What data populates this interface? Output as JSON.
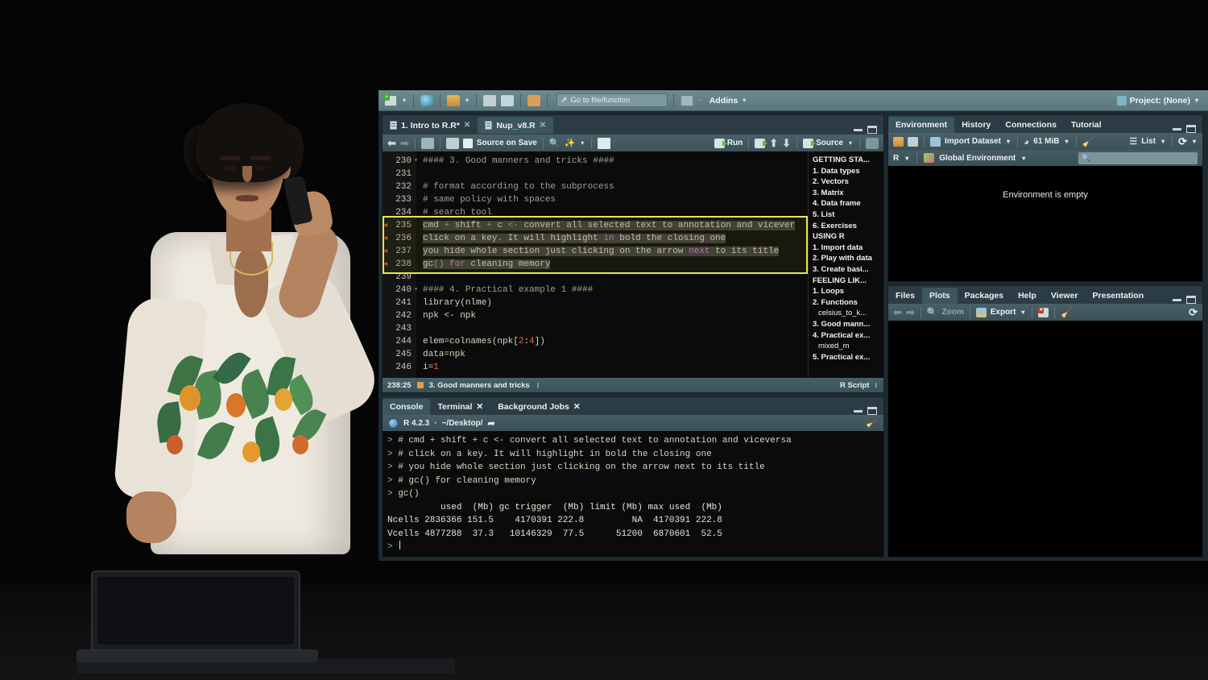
{
  "app": {
    "name": "RStudio"
  },
  "main_toolbar": {
    "icons": [
      "new-file-icon",
      "new-project-icon",
      "open-file-icon",
      "save-icon",
      "save-all-icon",
      "print-icon"
    ],
    "goto": {
      "placeholder": "Go to file/function",
      "icon": "magnifier-arrow-icon"
    },
    "addins_label": "Addins",
    "project_label": "Project: (None)"
  },
  "source_pane": {
    "tabs": [
      {
        "label": "1. Intro to R.R*",
        "active": false,
        "closable": true
      },
      {
        "label": "Nup_v8.R",
        "active": true,
        "closable": true
      }
    ],
    "toolbar": {
      "back_icon": "back-arrow-icon",
      "forward_icon": "forward-arrow-icon",
      "show_doc_outline_icon": "show-in-new-window-icon",
      "save_icon": "save-icon",
      "source_on_save_label": "Source on Save",
      "find_icon": "magnifier-icon",
      "magic_icon": "code-tools-icon",
      "compile_report_icon": "compile-report-icon",
      "run_label": "Run",
      "rerun_icon": "rerun-icon",
      "prev_chunk_icon": "up-arrow-icon",
      "next_chunk_icon": "down-arrow-icon",
      "source_label": "Source",
      "outline_icon": "outline-toggle-icon"
    },
    "code_lines": [
      {
        "num": "230",
        "fold": true,
        "segments": [
          {
            "t": "#### 3. Good manners and tricks ####",
            "c": "kw-com"
          }
        ]
      },
      {
        "num": "231",
        "fold": false,
        "segments": [
          {
            "t": "",
            "c": ""
          }
        ]
      },
      {
        "num": "232",
        "fold": false,
        "segments": [
          {
            "t": "# format according to the subprocess",
            "c": "kw-com"
          }
        ]
      },
      {
        "num": "233",
        "fold": false,
        "segments": [
          {
            "t": "# same policy with spaces",
            "c": "kw-com"
          }
        ]
      },
      {
        "num": "234",
        "fold": false,
        "segments": [
          {
            "t": "# search tool",
            "c": "kw-com"
          }
        ]
      },
      {
        "num": "235",
        "fold": false,
        "breakpoint": true,
        "selected": true,
        "segments": [
          {
            "t": "cmd ",
            "c": "kw-fn"
          },
          {
            "t": "+",
            "c": "kw-op"
          },
          {
            "t": " shift ",
            "c": "kw-fn"
          },
          {
            "t": "+",
            "c": "kw-op"
          },
          {
            "t": " c ",
            "c": "kw-fn"
          },
          {
            "t": "<-",
            "c": "kw-op"
          },
          {
            "t": " convert all selected text to annotation and vicever",
            "c": "kw-fn"
          }
        ]
      },
      {
        "num": "236",
        "fold": false,
        "breakpoint": true,
        "selected": true,
        "segments": [
          {
            "t": "click on a key. It will highlight ",
            "c": "kw-fn"
          },
          {
            "t": "in",
            "c": "kw-pk"
          },
          {
            "t": " bold the closing one",
            "c": "kw-fn"
          }
        ]
      },
      {
        "num": "237",
        "fold": false,
        "breakpoint": true,
        "selected": true,
        "segments": [
          {
            "t": "you hide whole section just clicking on the arrow ",
            "c": "kw-fn"
          },
          {
            "t": "next",
            "c": "kw-pk"
          },
          {
            "t": " to its title",
            "c": "kw-fn"
          }
        ]
      },
      {
        "num": "238",
        "fold": false,
        "breakpoint": true,
        "selected": true,
        "segments": [
          {
            "t": "gc",
            "c": "kw-fn"
          },
          {
            "t": "()",
            "c": "kw-op"
          },
          {
            "t": " for",
            "c": "kw-pk"
          },
          {
            "t": " cleaning memory",
            "c": "kw-fn"
          }
        ]
      },
      {
        "num": "239",
        "fold": false,
        "segments": [
          {
            "t": "",
            "c": ""
          }
        ]
      },
      {
        "num": "240",
        "fold": true,
        "segments": [
          {
            "t": "#### 4. Practical example 1 ####",
            "c": "kw-com"
          }
        ]
      },
      {
        "num": "241",
        "fold": false,
        "segments": [
          {
            "t": "library(nlme)",
            "c": "kw-fn"
          }
        ]
      },
      {
        "num": "242",
        "fold": false,
        "segments": [
          {
            "t": "npk <- npk",
            "c": "kw-fn"
          }
        ]
      },
      {
        "num": "243",
        "fold": false,
        "segments": [
          {
            "t": "",
            "c": ""
          }
        ]
      },
      {
        "num": "244",
        "fold": false,
        "segments": [
          {
            "t": "elem=colnames(npk[",
            "c": "kw-fn"
          },
          {
            "t": "2",
            "c": "kw-num"
          },
          {
            "t": ":",
            "c": "kw-fn"
          },
          {
            "t": "4",
            "c": "kw-num"
          },
          {
            "t": "])",
            "c": "kw-fn"
          }
        ]
      },
      {
        "num": "245",
        "fold": false,
        "segments": [
          {
            "t": "data=npk",
            "c": "kw-fn"
          }
        ]
      },
      {
        "num": "246",
        "fold": false,
        "segments": [
          {
            "t": "i=",
            "c": "kw-fn"
          },
          {
            "t": "1",
            "c": "kw-num"
          }
        ]
      }
    ],
    "outline": [
      {
        "label": "GETTING STA...",
        "sub": false
      },
      {
        "label": "1. Data types",
        "sub": false
      },
      {
        "label": "2. Vectors",
        "sub": false
      },
      {
        "label": "3. Matrix",
        "sub": false
      },
      {
        "label": "4. Data frame",
        "sub": false
      },
      {
        "label": "5. List",
        "sub": false
      },
      {
        "label": "6. Exercises",
        "sub": false
      },
      {
        "label": "USING R",
        "sub": false
      },
      {
        "label": "1. Import data",
        "sub": false
      },
      {
        "label": "2. Play with data",
        "sub": false
      },
      {
        "label": "3. Create basi...",
        "sub": false
      },
      {
        "label": "FEELING LIK...",
        "sub": false
      },
      {
        "label": "1. Loops",
        "sub": false
      },
      {
        "label": "2. Functions",
        "sub": false
      },
      {
        "label": "celsius_to_k...",
        "sub": true
      },
      {
        "label": "3. Good mann...",
        "sub": false
      },
      {
        "label": "4. Practical ex...",
        "sub": false
      },
      {
        "label": "mixed_m",
        "sub": true
      },
      {
        "label": "5. Practical ex...",
        "sub": false
      }
    ],
    "status": {
      "cursor_position": "238:25",
      "section_label": "3. Good manners and tricks",
      "file_type": "R Script"
    }
  },
  "console_pane": {
    "tabs": [
      {
        "label": "Console",
        "active": true,
        "closable": false
      },
      {
        "label": "Terminal",
        "active": false,
        "closable": true
      },
      {
        "label": "Background Jobs",
        "active": false,
        "closable": true
      }
    ],
    "path_row": {
      "version": "R 4.2.3",
      "separator": "·",
      "path": "~/Desktop/",
      "broom_icon": "broom-icon"
    },
    "lines": [
      {
        "prompt": "> ",
        "text": "# cmd + shift + c <- convert all selected text to annotation and viceversa",
        "cls": "cmt"
      },
      {
        "prompt": "> ",
        "text": "# click on a key. It will highlight in bold the closing one",
        "cls": "cmt"
      },
      {
        "prompt": "> ",
        "text": "# you hide whole section just clicking on the arrow next to its title",
        "cls": "cmt"
      },
      {
        "prompt": "> ",
        "text": "# gc() for cleaning memory",
        "cls": "cmt"
      },
      {
        "prompt": "> ",
        "text": "gc()",
        "cls": "cmt"
      },
      {
        "prompt": "",
        "text": "          used  (Mb) gc trigger  (Mb) limit (Mb) max used  (Mb)",
        "cls": ""
      },
      {
        "prompt": "",
        "text": "Ncells 2836366 151.5    4170391 222.8         NA  4170391 222.8",
        "cls": ""
      },
      {
        "prompt": "",
        "text": "Vcells 4877288  37.3   10146329  77.5      51200  6870601  52.5",
        "cls": ""
      }
    ],
    "final_prompt": "> "
  },
  "env_pane": {
    "tabs": [
      {
        "label": "Environment",
        "active": true
      },
      {
        "label": "History",
        "active": false
      },
      {
        "label": "Connections",
        "active": false
      },
      {
        "label": "Tutorial",
        "active": false
      }
    ],
    "toolbar": {
      "load_icon": "open-folder-icon",
      "save_icon": "save-icon",
      "import_label": "Import Dataset",
      "memory_label": "61 MiB",
      "memory_icon": "memory-gauge-icon",
      "clear_icon": "broom-icon",
      "view_label": "List",
      "view_icon": "list-icon",
      "refresh_icon": "refresh-icon"
    },
    "scope_row": {
      "language": "R",
      "environment_label": "Global Environment",
      "env_icon": "globe-cube-icon",
      "search_placeholder": "",
      "search_icon": "search-icon"
    },
    "empty_message": "Environment is empty"
  },
  "files_pane": {
    "tabs": [
      {
        "label": "Files",
        "active": false
      },
      {
        "label": "Plots",
        "active": true
      },
      {
        "label": "Packages",
        "active": false
      },
      {
        "label": "Help",
        "active": false
      },
      {
        "label": "Viewer",
        "active": false
      },
      {
        "label": "Presentation",
        "active": false
      }
    ],
    "toolbar": {
      "back_icon": "back-arrow-icon",
      "forward_icon": "forward-arrow-icon",
      "zoom_label": "Zoom",
      "zoom_icon": "magnifier-icon",
      "export_label": "Export",
      "export_icon": "export-image-icon",
      "remove_icon": "remove-plot-icon",
      "clear_all_icon": "broom-icon",
      "refresh_icon": "refresh-icon"
    }
  },
  "colors": {
    "chrome": "#41585f",
    "tab_active": "#3d555e",
    "editor_bg": "#0b0b0b",
    "highlight_border": "#e8e84a",
    "selection": "#3d3d3d",
    "accent_green": "#57bf4b",
    "number_orange": "#e8663a",
    "keyword_pink": "#cc7bd6"
  }
}
